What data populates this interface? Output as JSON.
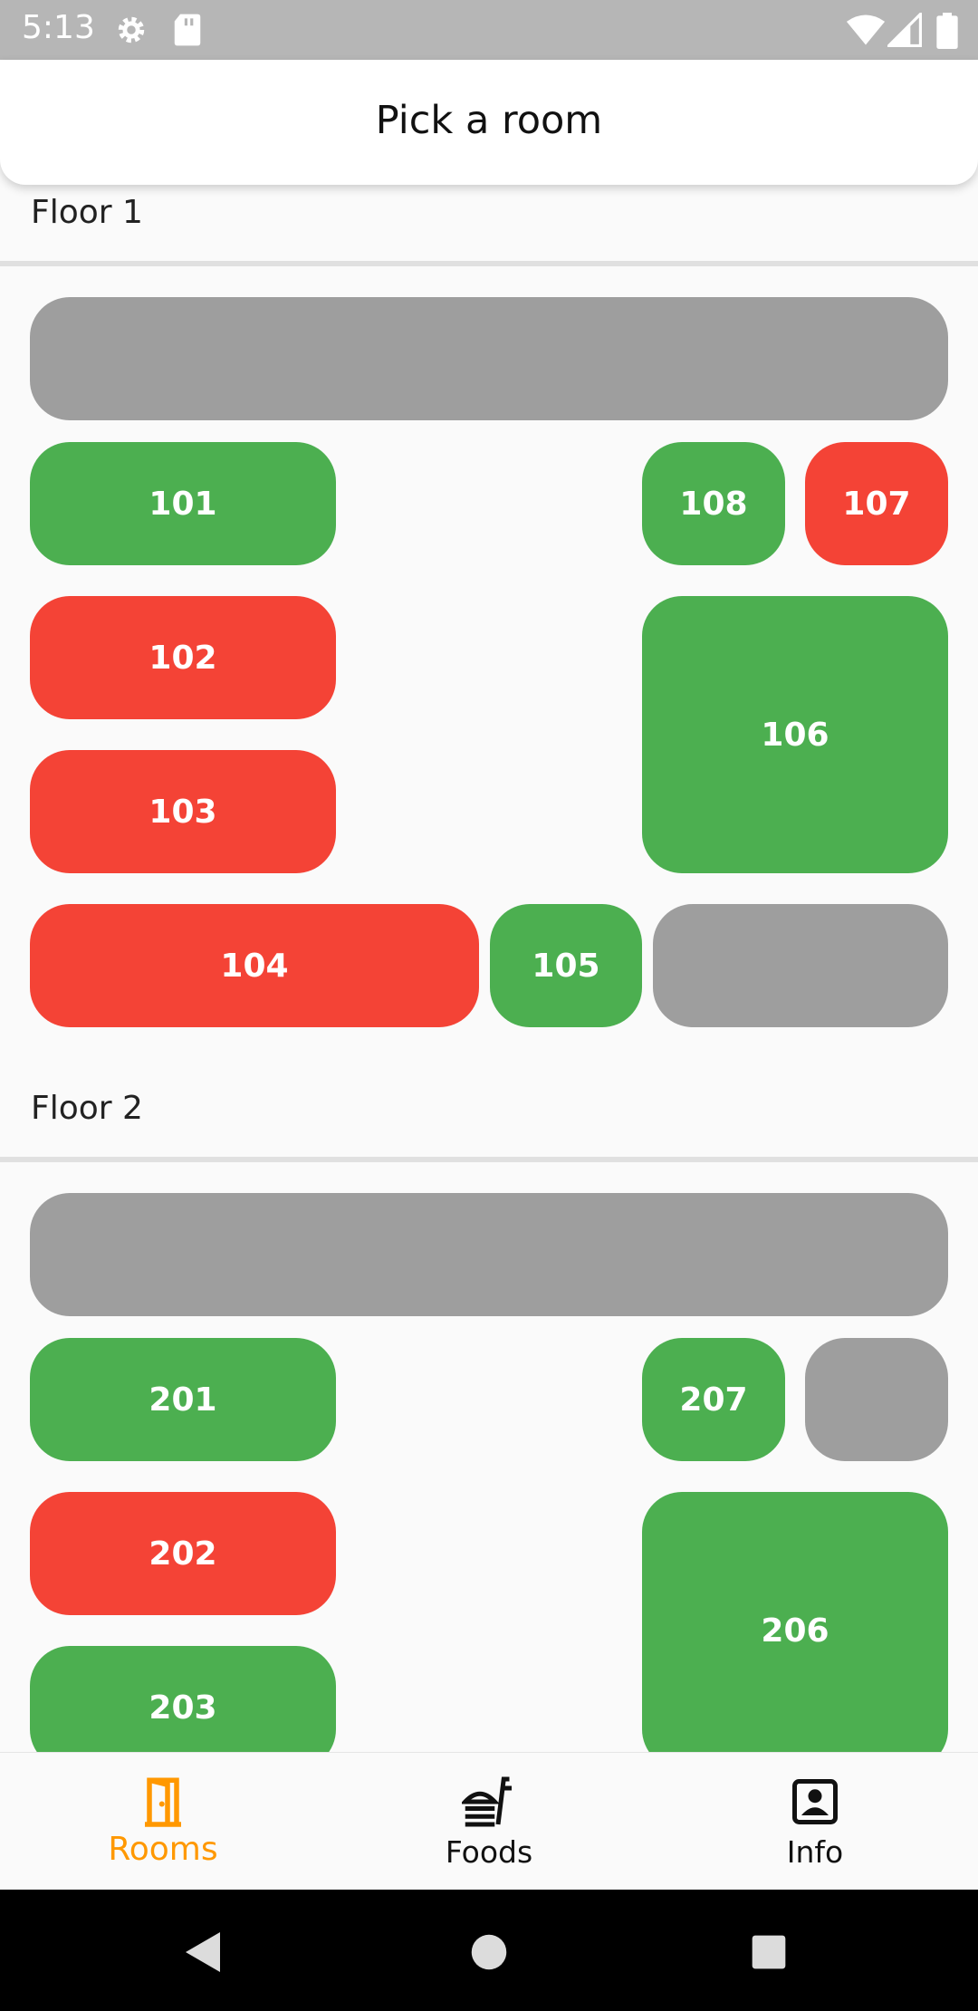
{
  "status_bar": {
    "time": "5:13"
  },
  "app_bar": {
    "title": "Pick a room"
  },
  "floors": [
    {
      "label": "Floor 1"
    },
    {
      "label": "Floor 2"
    }
  ],
  "rooms": {
    "r101": "101",
    "r102": "102",
    "r103": "103",
    "r104": "104",
    "r105": "105",
    "r106": "106",
    "r107": "107",
    "r108": "108",
    "r201": "201",
    "r202": "202",
    "r203": "203",
    "r206": "206",
    "r207": "207"
  },
  "bottom_nav": {
    "rooms": "Rooms",
    "foods": "Foods",
    "info": "Info"
  },
  "colors": {
    "available": "#4caf50",
    "occupied": "#f44336",
    "unavailable": "#9e9e9e",
    "active_tab": "#ff9800"
  }
}
